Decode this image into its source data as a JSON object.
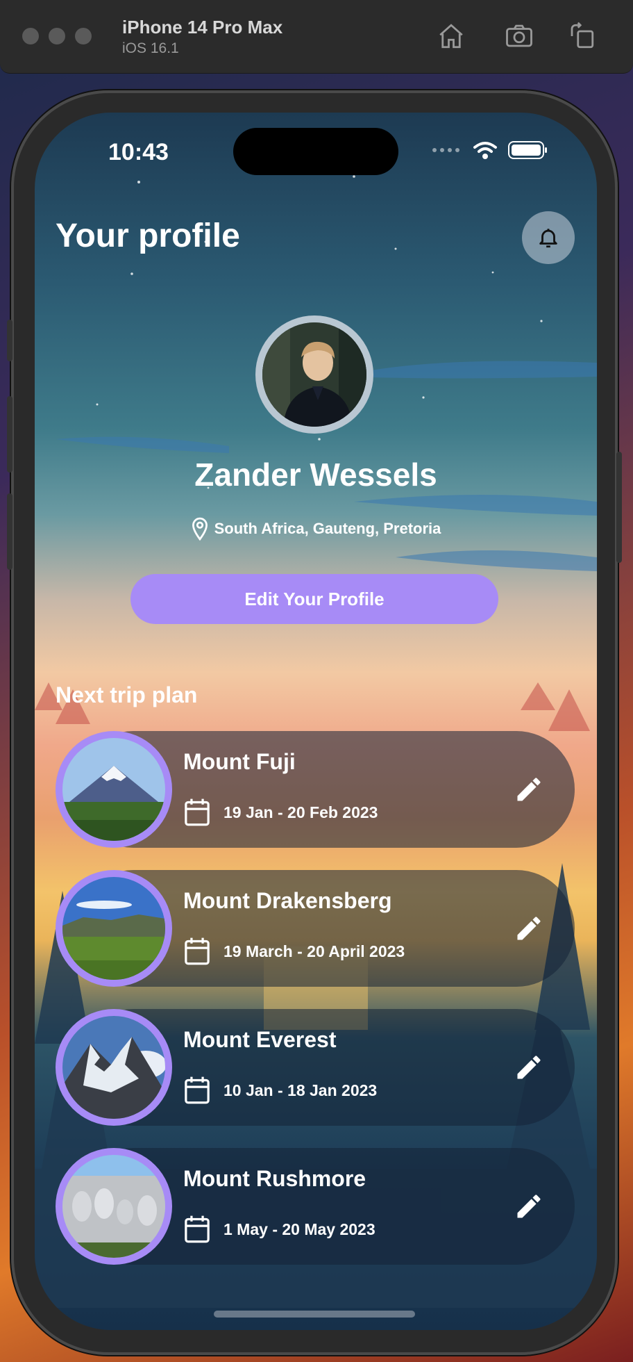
{
  "simulator": {
    "device": "iPhone 14 Pro Max",
    "os": "iOS 16.1",
    "icons": [
      "home-icon",
      "screenshot-icon",
      "rotate-icon"
    ]
  },
  "status_bar": {
    "time": "10:43"
  },
  "header": {
    "title": "Your profile",
    "bell_icon": "bell-icon"
  },
  "profile": {
    "name": "Zander Wessels",
    "location": "South Africa, Gauteng, Pretoria",
    "edit_label": "Edit Your Profile"
  },
  "trips": {
    "title": "Next trip plan",
    "items": [
      {
        "name": "Mount Fuji",
        "dates": "19 Jan - 20 Feb 2023"
      },
      {
        "name": "Mount Drakensberg",
        "dates": "19 March - 20 April 2023"
      },
      {
        "name": "Mount Everest",
        "dates": "10 Jan - 18 Jan 2023"
      },
      {
        "name": "Mount Rushmore",
        "dates": "1 May - 20 May 2023"
      }
    ]
  },
  "colors": {
    "accent": "#a78bf6",
    "bell_bg": "#c8d2dc"
  }
}
